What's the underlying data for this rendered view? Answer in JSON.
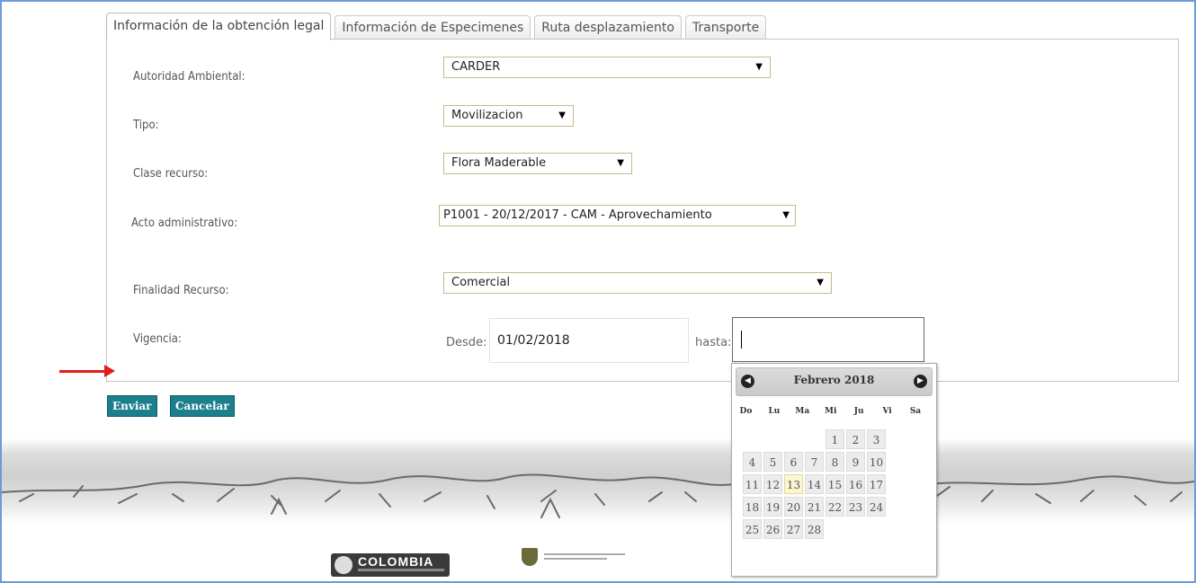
{
  "tabs": [
    {
      "label": "Información de la obtención legal",
      "active": true
    },
    {
      "label": "Información de Especimenes"
    },
    {
      "label": "Ruta desplazamiento"
    },
    {
      "label": "Transporte"
    }
  ],
  "form": {
    "autoridad_label": "Autoridad Ambiental:",
    "autoridad_value": "CARDER",
    "tipo_label": "Tipo:",
    "tipo_value": "Movilizacion",
    "clase_label": "Clase recurso:",
    "clase_value": "Flora Maderable",
    "acto_label": "Acto administrativo:",
    "acto_value": "P1001 - 20/12/2017 - CAM - Aprovechamiento",
    "finalidad_label": "Finalidad Recurso:",
    "finalidad_value": "Comercial",
    "vigencia_label": "Vigencia:",
    "desde_label": "Desde:",
    "desde_value": "01/02/2018",
    "hasta_label": "hasta:",
    "hasta_value": ""
  },
  "buttons": {
    "submit": "Enviar",
    "cancel": "Cancelar"
  },
  "datepicker": {
    "title": "Febrero 2018",
    "weekdays": [
      "Do",
      "Lu",
      "Ma",
      "Mi",
      "Ju",
      "Vi",
      "Sa"
    ],
    "weeks": [
      [
        "",
        "",
        "",
        "",
        "1",
        "2",
        "3"
      ],
      [
        "4",
        "5",
        "6",
        "7",
        "8",
        "9",
        "10"
      ],
      [
        "11",
        "12",
        "13",
        "14",
        "15",
        "16",
        "17"
      ],
      [
        "18",
        "19",
        "20",
        "21",
        "22",
        "23",
        "24"
      ],
      [
        "25",
        "26",
        "27",
        "28",
        "",
        "",
        ""
      ]
    ],
    "today": "13"
  },
  "footer": {
    "logo_text": "COLOMBIA"
  },
  "colors": {
    "accent": "#1c7f8c",
    "arrow": "#e41c1c",
    "frame": "#6d9bd8"
  }
}
